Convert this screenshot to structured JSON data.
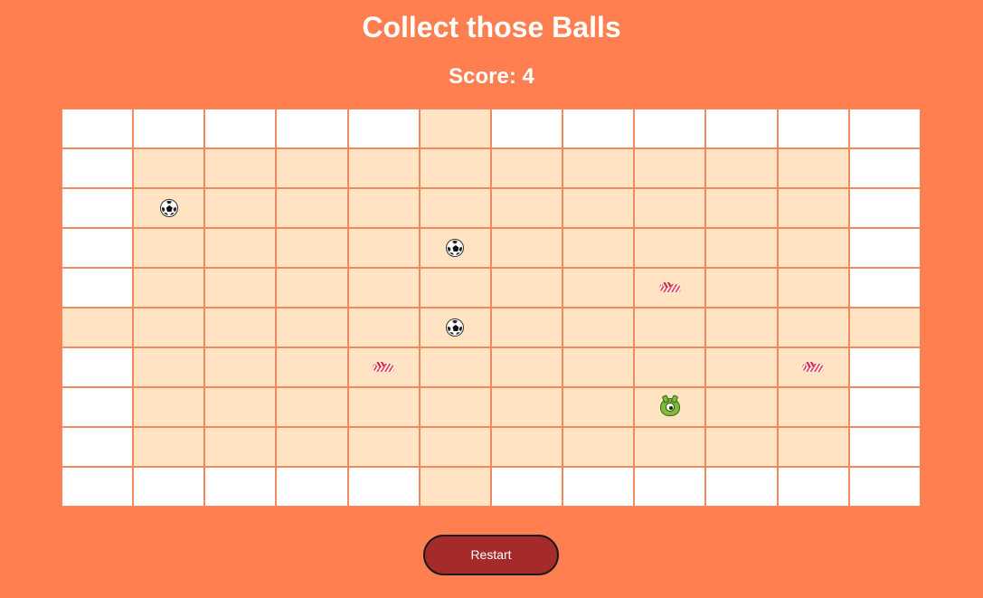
{
  "title": "Collect those Balls",
  "score_text": "Score: 4",
  "restart_label": "Restart",
  "colors": {
    "background": "#ff7f50",
    "wall": "#ffffff",
    "floor": "#ffe3c3",
    "grid_line": "#f08a5d",
    "button": "#a52a2a"
  },
  "board": {
    "columns": 12,
    "rows": 10,
    "cells": [
      [
        "wall",
        "wall",
        "wall",
        "wall",
        "wall",
        "floor",
        "wall",
        "wall",
        "wall",
        "wall",
        "wall",
        "wall"
      ],
      [
        "wall",
        "floor",
        "floor",
        "floor",
        "floor",
        "floor",
        "floor",
        "floor",
        "floor",
        "floor",
        "floor",
        "wall"
      ],
      [
        "wall",
        "floor:ball",
        "floor",
        "floor",
        "floor",
        "floor",
        "floor",
        "floor",
        "floor",
        "floor",
        "floor",
        "wall"
      ],
      [
        "wall",
        "floor",
        "floor",
        "floor",
        "floor",
        "floor:ball",
        "floor",
        "floor",
        "floor",
        "floor",
        "floor",
        "wall"
      ],
      [
        "wall",
        "floor",
        "floor",
        "floor",
        "floor",
        "floor",
        "floor",
        "floor",
        "floor:candy",
        "floor",
        "floor",
        "wall"
      ],
      [
        "floor",
        "floor",
        "floor",
        "floor",
        "floor",
        "floor:ball",
        "floor",
        "floor",
        "floor",
        "floor",
        "floor",
        "floor"
      ],
      [
        "wall",
        "floor",
        "floor",
        "floor",
        "floor:candy",
        "floor",
        "floor",
        "floor",
        "floor",
        "floor",
        "floor:candy",
        "wall"
      ],
      [
        "wall",
        "floor",
        "floor",
        "floor",
        "floor",
        "floor",
        "floor",
        "floor",
        "floor:player",
        "floor",
        "floor",
        "wall"
      ],
      [
        "wall",
        "floor",
        "floor",
        "floor",
        "floor",
        "floor",
        "floor",
        "floor",
        "floor",
        "floor",
        "floor",
        "wall"
      ],
      [
        "wall",
        "wall",
        "wall",
        "wall",
        "wall",
        "floor",
        "wall",
        "wall",
        "wall",
        "wall",
        "wall",
        "wall"
      ]
    ]
  },
  "icons": {
    "ball": "soccer-ball-icon",
    "candy": "candy-icon",
    "player": "green-monster-icon"
  }
}
